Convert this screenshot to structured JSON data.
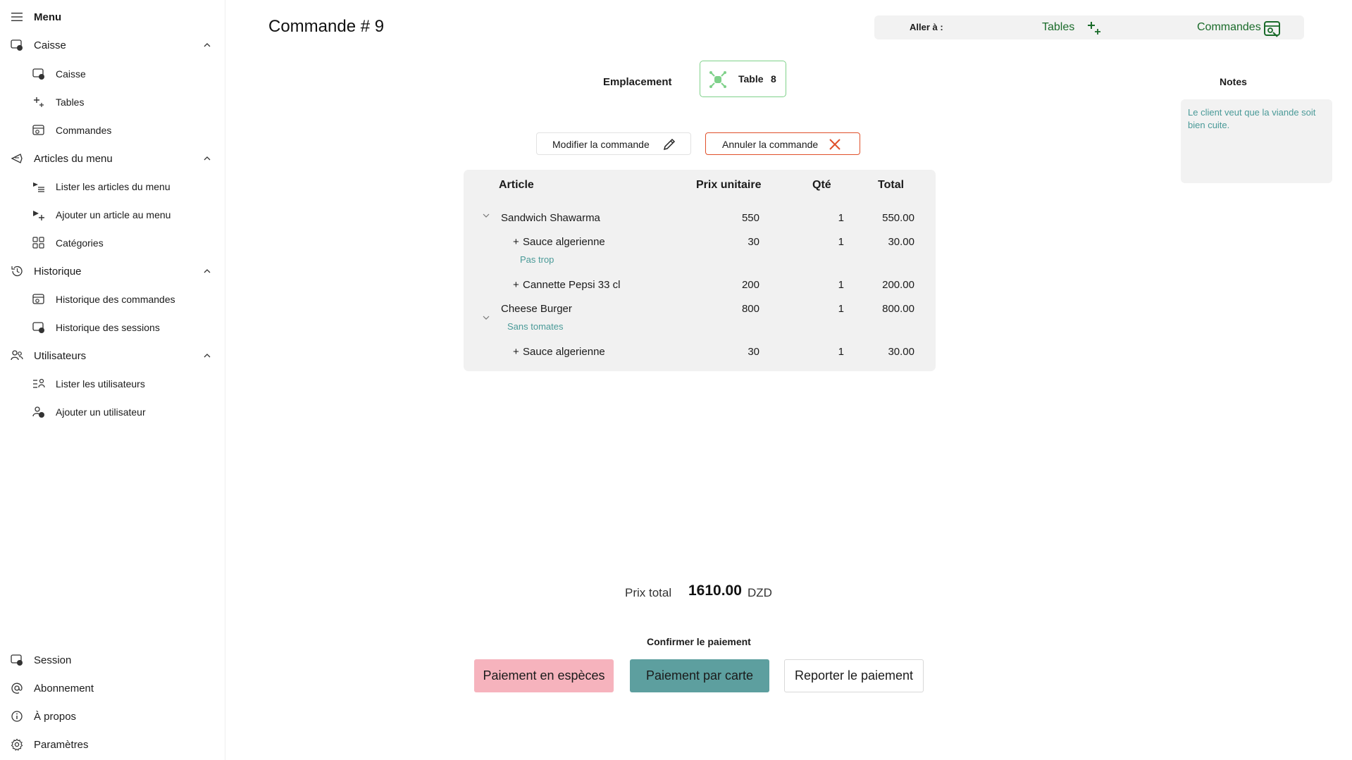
{
  "sidebar": {
    "menu_label": "Menu",
    "items": [
      {
        "label": "Caisse",
        "icon": "register-icon"
      },
      {
        "label": "Caisse",
        "icon": "register-icon"
      },
      {
        "label": "Tables",
        "icon": "sparkle-tables-icon"
      },
      {
        "label": "Commandes",
        "icon": "orders-icon"
      },
      {
        "label": "Articles du menu",
        "icon": "food-icon"
      },
      {
        "label": "Lister les articles du menu",
        "icon": "list-food-icon"
      },
      {
        "label": "Ajouter un article au menu",
        "icon": "add-food-icon"
      },
      {
        "label": "Catégories",
        "icon": "grid-icon"
      },
      {
        "label": "Historique",
        "icon": "history-icon"
      },
      {
        "label": "Historique des commandes",
        "icon": "orders-icon"
      },
      {
        "label": "Historique des sessions",
        "icon": "register-icon"
      },
      {
        "label": "Utilisateurs",
        "icon": "people-icon"
      },
      {
        "label": "Lister les utilisateurs",
        "icon": "list-people-icon"
      },
      {
        "label": "Ajouter un utilisateur",
        "icon": "add-person-icon"
      }
    ],
    "footer": [
      {
        "label": "Session",
        "icon": "register-icon"
      },
      {
        "label": "Abonnement",
        "icon": "at-icon"
      },
      {
        "label": "À propos",
        "icon": "info-icon"
      },
      {
        "label": "Paramètres",
        "icon": "gear-icon"
      }
    ]
  },
  "page": {
    "title": "Commande # 9"
  },
  "goto": {
    "label": "Aller à :",
    "tables": "Tables",
    "orders": "Commandes"
  },
  "location": {
    "label": "Emplacement",
    "table_label": "Table",
    "table_number": "8"
  },
  "actions": {
    "modify": "Modifier la commande",
    "cancel": "Annuler la commande"
  },
  "notes": {
    "title": "Notes",
    "text": "Le client veut que la viande soit bien cuite."
  },
  "order": {
    "headers": {
      "article": "Article",
      "unit_price": "Prix unitaire",
      "qty": "Qté",
      "total": "Total"
    },
    "rows": [
      {
        "name": "Sandwich Shawarma",
        "price": "550",
        "qty": "1",
        "total": "550.00"
      },
      {
        "name": "Sauce algerienne",
        "prefix": "+",
        "price": "30",
        "qty": "1",
        "total": "30.00",
        "note": "Pas trop"
      },
      {
        "name": "Cannette Pepsi 33 cl",
        "prefix": "+",
        "price": "200",
        "qty": "1",
        "total": "200.00"
      },
      {
        "name": "Cheese Burger",
        "price": "800",
        "qty": "1",
        "total": "800.00",
        "note": "Sans tomates"
      },
      {
        "name": "Sauce algerienne",
        "prefix": "+",
        "price": "30",
        "qty": "1",
        "total": "30.00"
      }
    ]
  },
  "totals": {
    "label": "Prix total",
    "value": "1610.00",
    "currency": "DZD"
  },
  "payment": {
    "confirm_label": "Confirmer le paiement",
    "cash": "Paiement en espèces",
    "card": "Paiement par carte",
    "later": "Reporter le paiement"
  },
  "colors": {
    "accent_green": "#1a6b2a",
    "note_teal": "#4a9a98",
    "cancel_red": "#e0502a",
    "cash_pink": "#f6b3bd",
    "card_teal": "#5d9f9f"
  }
}
